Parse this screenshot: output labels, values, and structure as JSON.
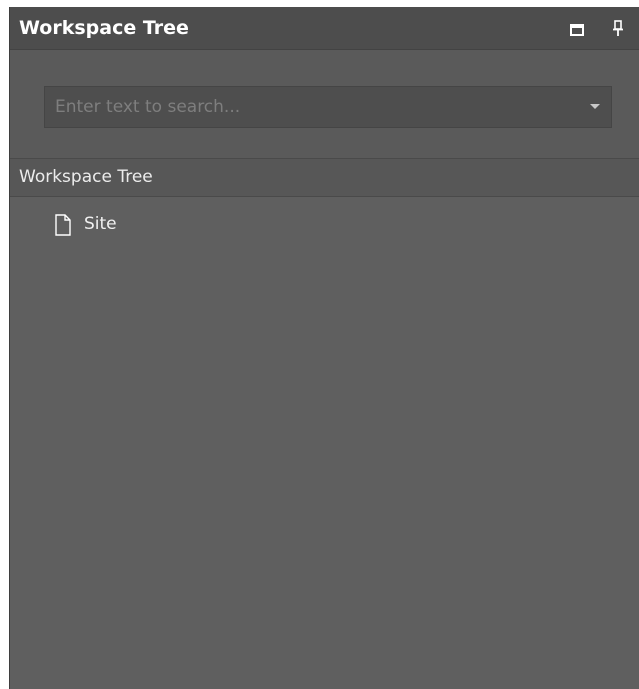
{
  "panel": {
    "title": "Workspace Tree",
    "controls": {
      "maximize_icon": "maximize-icon",
      "pin_icon": "pin-icon"
    }
  },
  "search": {
    "placeholder": "Enter text to search...",
    "value": "",
    "dropdown_icon": "chevron-down-icon"
  },
  "tree": {
    "header": "Workspace Tree",
    "items": [
      {
        "label": "Site",
        "icon": "page-icon"
      }
    ]
  },
  "colors": {
    "panel_background": "#5f5f5f",
    "title_bar": "#4d4d4d",
    "text": "#ffffff"
  }
}
